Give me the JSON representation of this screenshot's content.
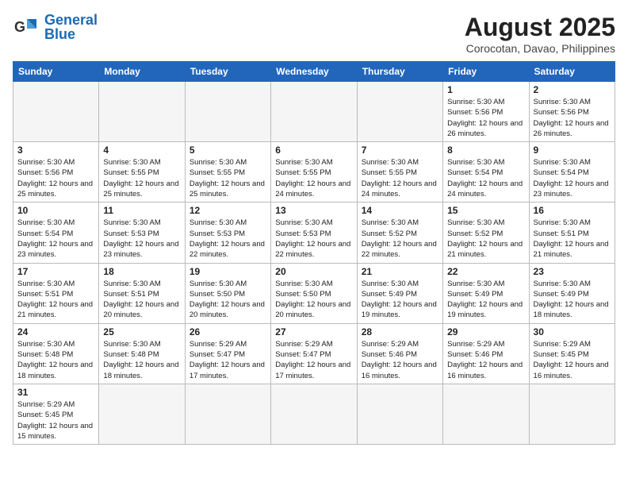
{
  "header": {
    "logo_general": "General",
    "logo_blue": "Blue",
    "month_year": "August 2025",
    "location": "Corocotan, Davao, Philippines"
  },
  "weekdays": [
    "Sunday",
    "Monday",
    "Tuesday",
    "Wednesday",
    "Thursday",
    "Friday",
    "Saturday"
  ],
  "weeks": [
    [
      {
        "day": "",
        "info": ""
      },
      {
        "day": "",
        "info": ""
      },
      {
        "day": "",
        "info": ""
      },
      {
        "day": "",
        "info": ""
      },
      {
        "day": "",
        "info": ""
      },
      {
        "day": "1",
        "info": "Sunrise: 5:30 AM\nSunset: 5:56 PM\nDaylight: 12 hours\nand 26 minutes."
      },
      {
        "day": "2",
        "info": "Sunrise: 5:30 AM\nSunset: 5:56 PM\nDaylight: 12 hours\nand 26 minutes."
      }
    ],
    [
      {
        "day": "3",
        "info": "Sunrise: 5:30 AM\nSunset: 5:56 PM\nDaylight: 12 hours\nand 25 minutes."
      },
      {
        "day": "4",
        "info": "Sunrise: 5:30 AM\nSunset: 5:55 PM\nDaylight: 12 hours\nand 25 minutes."
      },
      {
        "day": "5",
        "info": "Sunrise: 5:30 AM\nSunset: 5:55 PM\nDaylight: 12 hours\nand 25 minutes."
      },
      {
        "day": "6",
        "info": "Sunrise: 5:30 AM\nSunset: 5:55 PM\nDaylight: 12 hours\nand 24 minutes."
      },
      {
        "day": "7",
        "info": "Sunrise: 5:30 AM\nSunset: 5:55 PM\nDaylight: 12 hours\nand 24 minutes."
      },
      {
        "day": "8",
        "info": "Sunrise: 5:30 AM\nSunset: 5:54 PM\nDaylight: 12 hours\nand 24 minutes."
      },
      {
        "day": "9",
        "info": "Sunrise: 5:30 AM\nSunset: 5:54 PM\nDaylight: 12 hours\nand 23 minutes."
      }
    ],
    [
      {
        "day": "10",
        "info": "Sunrise: 5:30 AM\nSunset: 5:54 PM\nDaylight: 12 hours\nand 23 minutes."
      },
      {
        "day": "11",
        "info": "Sunrise: 5:30 AM\nSunset: 5:53 PM\nDaylight: 12 hours\nand 23 minutes."
      },
      {
        "day": "12",
        "info": "Sunrise: 5:30 AM\nSunset: 5:53 PM\nDaylight: 12 hours\nand 22 minutes."
      },
      {
        "day": "13",
        "info": "Sunrise: 5:30 AM\nSunset: 5:53 PM\nDaylight: 12 hours\nand 22 minutes."
      },
      {
        "day": "14",
        "info": "Sunrise: 5:30 AM\nSunset: 5:52 PM\nDaylight: 12 hours\nand 22 minutes."
      },
      {
        "day": "15",
        "info": "Sunrise: 5:30 AM\nSunset: 5:52 PM\nDaylight: 12 hours\nand 21 minutes."
      },
      {
        "day": "16",
        "info": "Sunrise: 5:30 AM\nSunset: 5:51 PM\nDaylight: 12 hours\nand 21 minutes."
      }
    ],
    [
      {
        "day": "17",
        "info": "Sunrise: 5:30 AM\nSunset: 5:51 PM\nDaylight: 12 hours\nand 21 minutes."
      },
      {
        "day": "18",
        "info": "Sunrise: 5:30 AM\nSunset: 5:51 PM\nDaylight: 12 hours\nand 20 minutes."
      },
      {
        "day": "19",
        "info": "Sunrise: 5:30 AM\nSunset: 5:50 PM\nDaylight: 12 hours\nand 20 minutes."
      },
      {
        "day": "20",
        "info": "Sunrise: 5:30 AM\nSunset: 5:50 PM\nDaylight: 12 hours\nand 20 minutes."
      },
      {
        "day": "21",
        "info": "Sunrise: 5:30 AM\nSunset: 5:49 PM\nDaylight: 12 hours\nand 19 minutes."
      },
      {
        "day": "22",
        "info": "Sunrise: 5:30 AM\nSunset: 5:49 PM\nDaylight: 12 hours\nand 19 minutes."
      },
      {
        "day": "23",
        "info": "Sunrise: 5:30 AM\nSunset: 5:49 PM\nDaylight: 12 hours\nand 18 minutes."
      }
    ],
    [
      {
        "day": "24",
        "info": "Sunrise: 5:30 AM\nSunset: 5:48 PM\nDaylight: 12 hours\nand 18 minutes."
      },
      {
        "day": "25",
        "info": "Sunrise: 5:30 AM\nSunset: 5:48 PM\nDaylight: 12 hours\nand 18 minutes."
      },
      {
        "day": "26",
        "info": "Sunrise: 5:29 AM\nSunset: 5:47 PM\nDaylight: 12 hours\nand 17 minutes."
      },
      {
        "day": "27",
        "info": "Sunrise: 5:29 AM\nSunset: 5:47 PM\nDaylight: 12 hours\nand 17 minutes."
      },
      {
        "day": "28",
        "info": "Sunrise: 5:29 AM\nSunset: 5:46 PM\nDaylight: 12 hours\nand 16 minutes."
      },
      {
        "day": "29",
        "info": "Sunrise: 5:29 AM\nSunset: 5:46 PM\nDaylight: 12 hours\nand 16 minutes."
      },
      {
        "day": "30",
        "info": "Sunrise: 5:29 AM\nSunset: 5:45 PM\nDaylight: 12 hours\nand 16 minutes."
      }
    ],
    [
      {
        "day": "31",
        "info": "Sunrise: 5:29 AM\nSunset: 5:45 PM\nDaylight: 12 hours\nand 15 minutes."
      },
      {
        "day": "",
        "info": ""
      },
      {
        "day": "",
        "info": ""
      },
      {
        "day": "",
        "info": ""
      },
      {
        "day": "",
        "info": ""
      },
      {
        "day": "",
        "info": ""
      },
      {
        "day": "",
        "info": ""
      }
    ]
  ]
}
